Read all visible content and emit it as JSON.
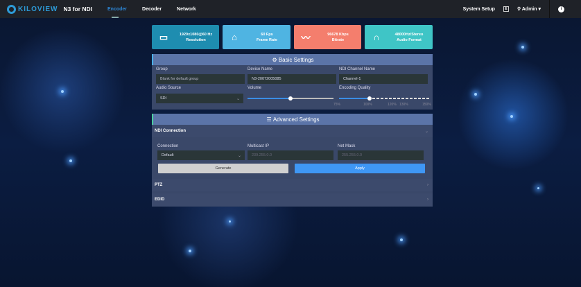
{
  "nav": {
    "brand": "KILOVIEW",
    "product": "N3 for NDI",
    "tabs": [
      "Encoder",
      "Decoder",
      "Network"
    ],
    "active_tab": "Encoder",
    "system_setup": "System Setup",
    "user": "Admin"
  },
  "cards": [
    {
      "value": "1920x1080@60 Hz",
      "label": "Resolution",
      "icon": "monitor-icon",
      "color": "#1e8db0"
    },
    {
      "value": "60 Fps",
      "label": "Frame Rate",
      "icon": "frame-rate-icon",
      "color": "#4fb4e2"
    },
    {
      "value": "96678 Kbps",
      "label": "Bitrate",
      "icon": "waveform-icon",
      "color": "#f47e6d"
    },
    {
      "value": "48000Hz/Stereo",
      "label": "Audio Format",
      "icon": "headphones-icon",
      "color": "#3fc5c6"
    }
  ],
  "basic": {
    "title": "Basic Settings",
    "group_label": "Group",
    "group_placeholder": "Blank for default group",
    "device_label": "Device Name",
    "device_value": "N3-20072005085",
    "channel_label": "NDI Channel Name",
    "channel_value": "Channel-1",
    "audio_label": "Audio Source",
    "audio_value": "SDI",
    "volume_label": "Volume",
    "volume_percent": 50,
    "quality_label": "Encoding Quality",
    "quality_value": "100%",
    "quality_ticks": [
      "75%",
      "100%",
      "120%",
      "130%",
      "150%"
    ]
  },
  "advanced": {
    "title": "Advanced Settings",
    "ndi_connection": "NDI Connection",
    "connection_label": "Connection",
    "connection_value": "Default",
    "multicast_label": "Multicast IP",
    "multicast_placeholder": "239.255.0.0",
    "netmask_label": "Net Mask",
    "netmask_placeholder": "255.255.0.0",
    "generate": "Generate",
    "apply": "Apply",
    "ptz": "PTZ",
    "edid": "EDID"
  }
}
